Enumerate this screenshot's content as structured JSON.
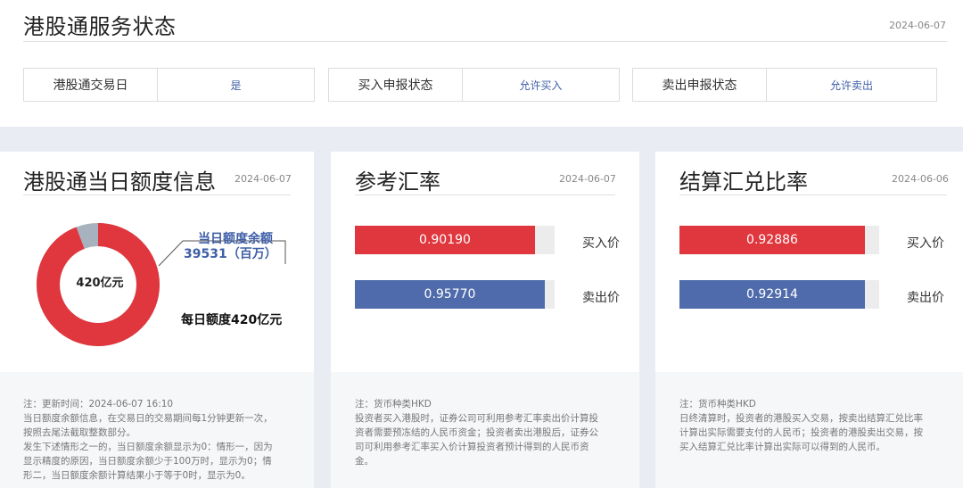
{
  "top": {
    "title": "港股通服务状态",
    "date": "2024-06-07",
    "statuses": [
      {
        "label": "港股通交易日",
        "value": "是"
      },
      {
        "label": "买入申报状态",
        "value": "允许买入"
      },
      {
        "label": "卖出申报状态",
        "value": "允许卖出"
      }
    ]
  },
  "quota": {
    "title": "港股通当日额度信息",
    "date": "2024-06-07",
    "center_label": "420亿元",
    "remaining_label": "当日额度余额",
    "remaining_value": "39531（百万）",
    "daily_label": "每日额度420亿元",
    "remaining_fraction": 0.941,
    "notes": [
      "注：更新时间：2024-06-07 16:10",
      "当日额度余额信息，在交易日的交易期间每1分钟更新一次，",
      "按照去尾法截取整数部分。",
      "发生下述情形之一的，当日额度余额显示为0：情形一，因为",
      "显示精度的原因，当日额度余额少于100万时，显示为0；情",
      "形二，当日额度余额计算结果小于等于0时，显示为0。"
    ]
  },
  "ref_rate": {
    "title": "参考汇率",
    "date": "2024-06-07",
    "buy": {
      "value": "0.90190",
      "label": "买入价",
      "fill": 0.9
    },
    "sell": {
      "value": "0.95770",
      "label": "卖出价",
      "fill": 0.95
    },
    "notes": [
      "注：货币种类HKD",
      "投资者买入港股时，证券公司可利用参考汇率卖出价计算投",
      "资者需要预冻结的人民币资金；投资者卖出港股后，证券公",
      "司可利用参考汇率买入价计算投资者预计得到的人民币资",
      "金。"
    ]
  },
  "settle_rate": {
    "title": "结算汇兑比率",
    "date": "2024-06-06",
    "buy": {
      "value": "0.92886",
      "label": "买入价",
      "fill": 0.93
    },
    "sell": {
      "value": "0.92914",
      "label": "卖出价",
      "fill": 0.93
    },
    "notes": [
      "注：货币种类HKD",
      "日终清算时，投资者的港股买入交易，按卖出结算汇兑比率",
      "计算出实际需要支付的人民币；投资者的港股卖出交易，按",
      "买入结算汇兑比率计算出实际可以得到的人民币。"
    ]
  },
  "colors": {
    "red": "#e0363d",
    "blue": "#4f6bab",
    "gray": "#a8b2be"
  }
}
